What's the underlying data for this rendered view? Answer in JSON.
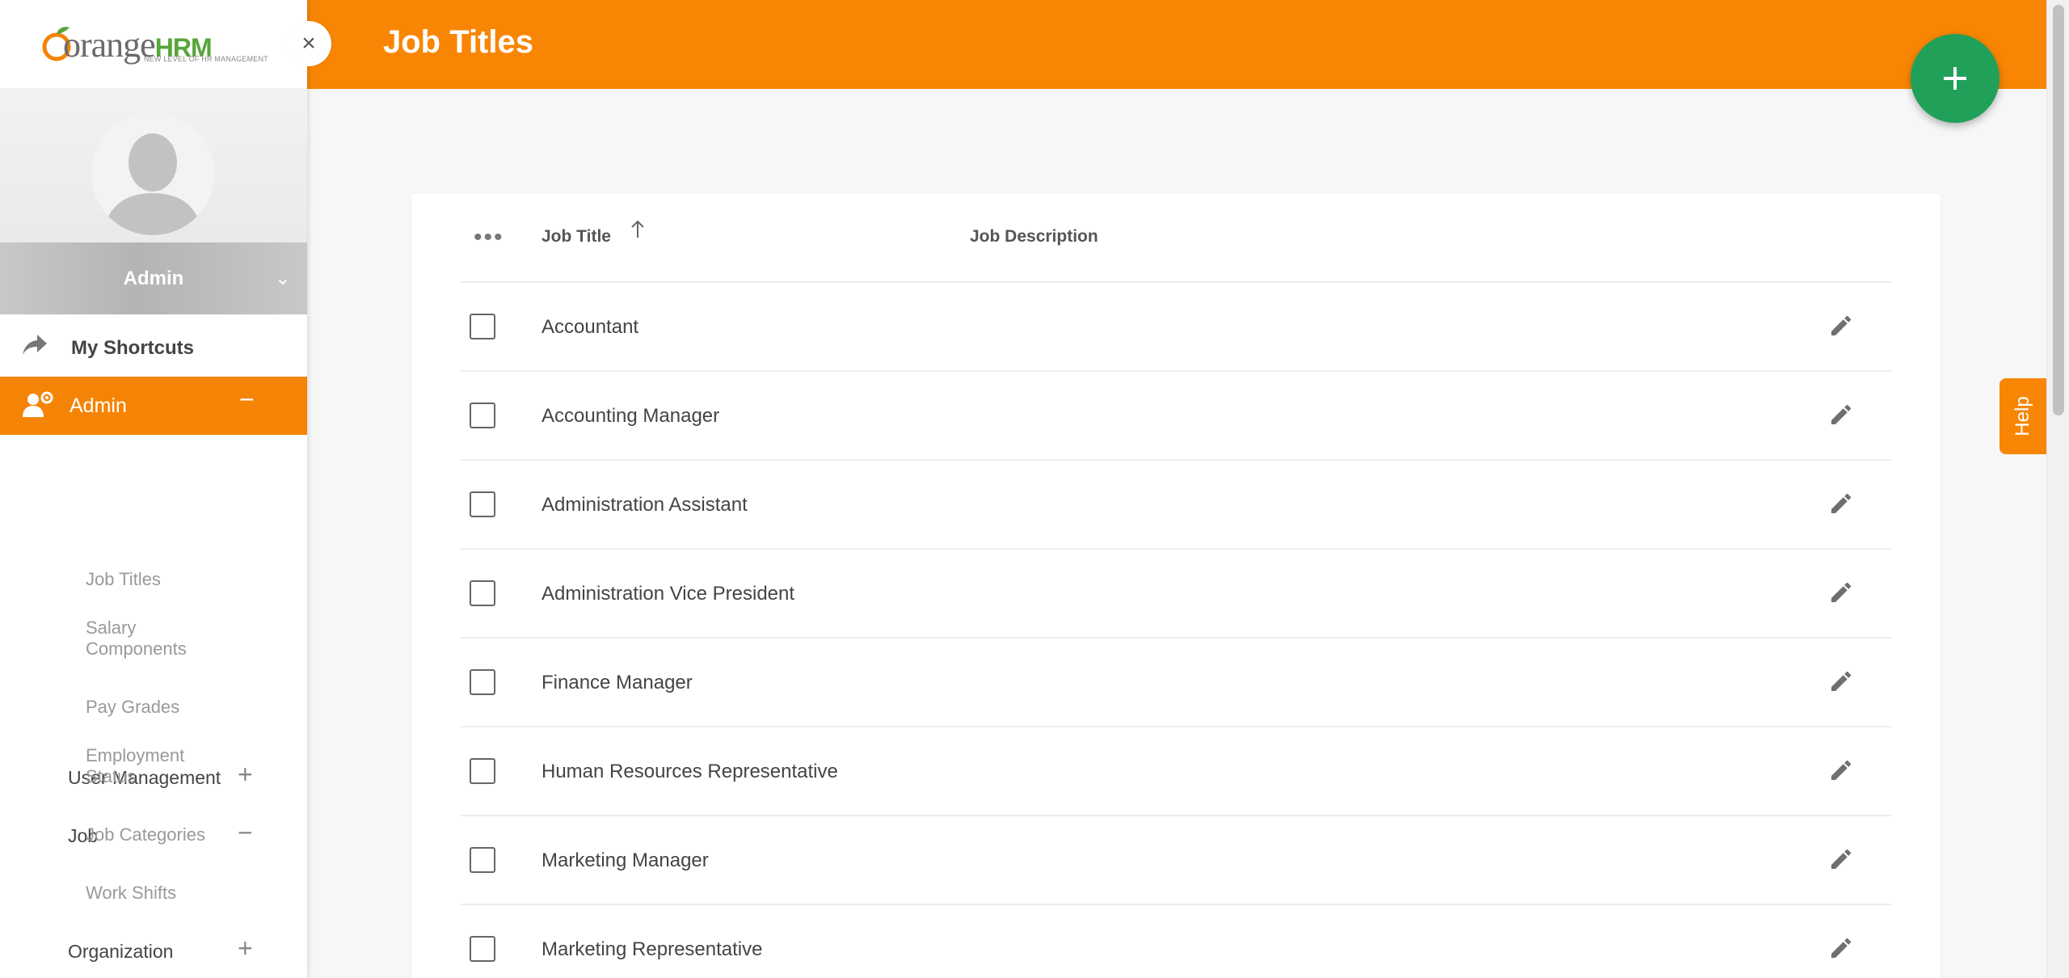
{
  "app": {
    "logo_text": "orange",
    "logo_accent": "HRM",
    "logo_tagline": "NEW LEVEL OF HR MANAGEMENT",
    "close_glyph": "×"
  },
  "colors": {
    "brand_orange": "#f88604",
    "fab_green": "#21a05a",
    "active_menu": "#f58406"
  },
  "profile": {
    "name": "Admin",
    "chevron": "⌄"
  },
  "menu": {
    "shortcuts_label": "My Shortcuts",
    "admin_label": "Admin",
    "admin_toggle": "−",
    "user_management": {
      "label": "User Management",
      "toggle": "+"
    },
    "job": {
      "label": "Job",
      "toggle": "−"
    },
    "job_items": [
      "Job Titles",
      "Salary Components",
      "Pay Grades",
      "Employment Status",
      "Job Categories",
      "Work Shifts"
    ],
    "organization": {
      "label": "Organization",
      "toggle": "+"
    }
  },
  "header": {
    "title": "Job Titles"
  },
  "table": {
    "columns": {
      "menu_glyph": "•••",
      "job_title": "Job Title",
      "job_description": "Job Description"
    },
    "rows": [
      {
        "title": "Accountant",
        "description": ""
      },
      {
        "title": "Accounting Manager",
        "description": ""
      },
      {
        "title": "Administration Assistant",
        "description": ""
      },
      {
        "title": "Administration Vice President",
        "description": ""
      },
      {
        "title": "Finance Manager",
        "description": ""
      },
      {
        "title": "Human Resources Representative",
        "description": ""
      },
      {
        "title": "Marketing Manager",
        "description": ""
      },
      {
        "title": "Marketing Representative",
        "description": ""
      }
    ]
  },
  "help": {
    "label": "Help"
  }
}
